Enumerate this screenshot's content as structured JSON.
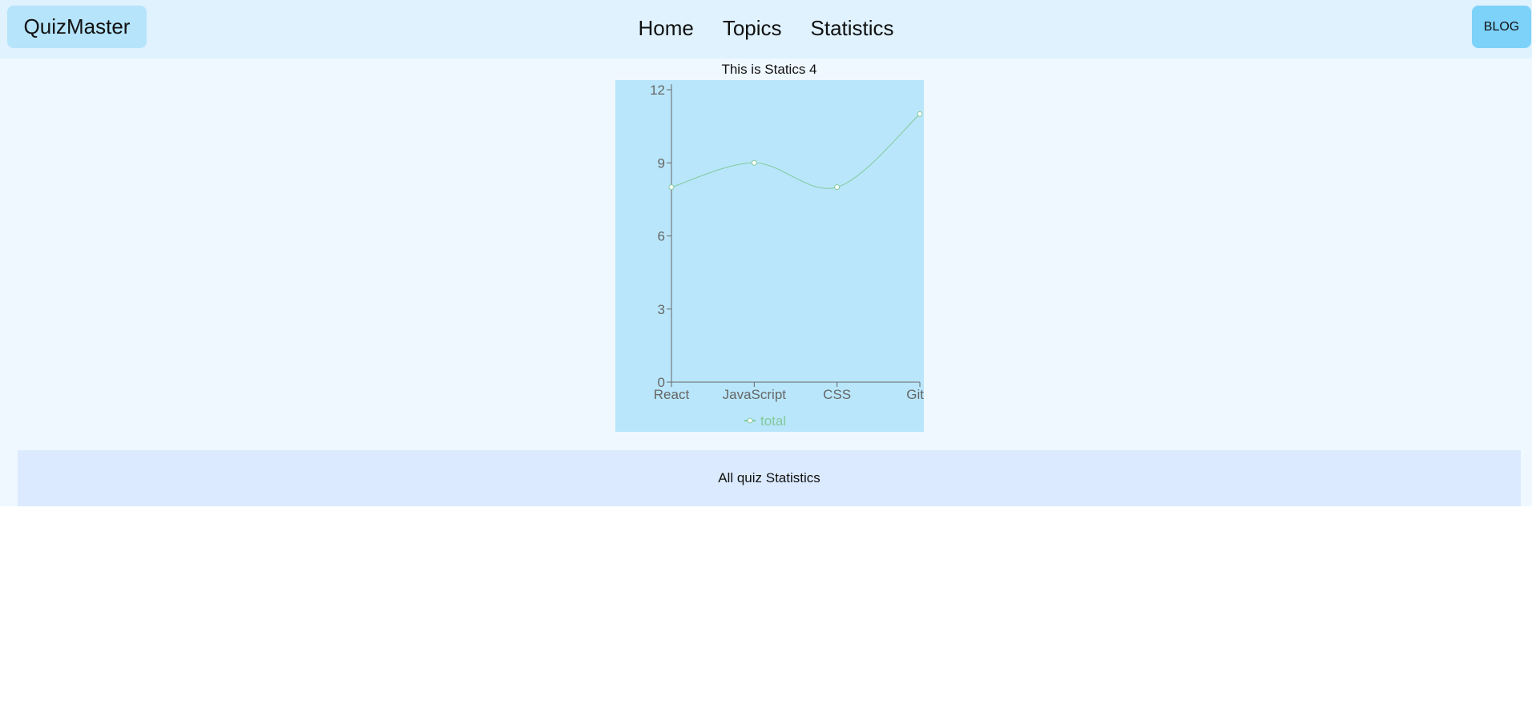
{
  "navbar": {
    "brand": "QuizMaster",
    "links": [
      "Home",
      "Topics",
      "Statistics"
    ],
    "blog_label": "BLOG"
  },
  "main": {
    "chart_heading": "This is Statics 4",
    "summary_label": "All quiz Statistics"
  },
  "colors": {
    "navbar_bg": "#dff2fe",
    "brand_bg": "#b6e4fb",
    "blog_bg": "#7dd2fa",
    "chart_bg": "#b9e6fa",
    "line": "#82ca9d",
    "summary_bg": "#dbeafe"
  },
  "chart_data": {
    "type": "line",
    "categories": [
      "React",
      "JavaScript",
      "CSS",
      "Git"
    ],
    "series": [
      {
        "name": "total",
        "values": [
          8,
          9,
          8,
          11
        ]
      }
    ],
    "yticks": [
      0,
      3,
      6,
      9,
      12
    ],
    "ylim": [
      0,
      12
    ],
    "curve": "smooth",
    "grid": false,
    "legend": "bottom"
  }
}
